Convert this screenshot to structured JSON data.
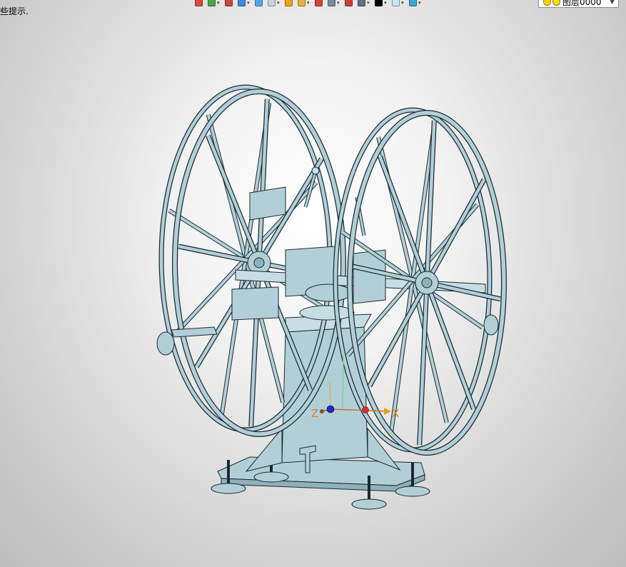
{
  "status": {
    "hint_text": "些提示."
  },
  "toolbar": {
    "buttons": [
      {
        "name": "import-icon",
        "color": "#d94a3a"
      },
      {
        "name": "layers-stack-icon",
        "color": "#4ca84a"
      },
      {
        "name": "pen-icon",
        "color": "#c8463a"
      },
      {
        "name": "cube-blue-icon",
        "color": "#3a8fd8"
      },
      {
        "name": "cube-shaded-icon",
        "color": "#5aa6e6"
      },
      {
        "name": "cube-wire-icon",
        "color": "#c8d2dc"
      },
      {
        "name": "render-mode-icon",
        "color": "#f0a020"
      },
      {
        "name": "texture-icon",
        "color": "#e8b040"
      },
      {
        "name": "move-axes-icon",
        "color": "#d84040"
      },
      {
        "name": "fit-view-icon",
        "color": "#7a8aa0"
      },
      {
        "name": "measure-icon",
        "color": "#c84040"
      },
      {
        "name": "cylinder-icon",
        "color": "#607080"
      },
      {
        "name": "color-black-icon",
        "color": "#000000"
      },
      {
        "name": "color-light-icon",
        "color": "#c8e8f0"
      },
      {
        "name": "layer-manager-icon",
        "color": "#40a8c8"
      }
    ]
  },
  "layer_select": {
    "value": "图层0000",
    "icons": [
      "light-bulb-icon",
      "layer-sun-icon"
    ]
  },
  "viewport": {
    "axis_labels": {
      "x": "X",
      "z": "Z"
    },
    "model_color": "#b2cfd8",
    "edge_color": "#1a2a30"
  }
}
